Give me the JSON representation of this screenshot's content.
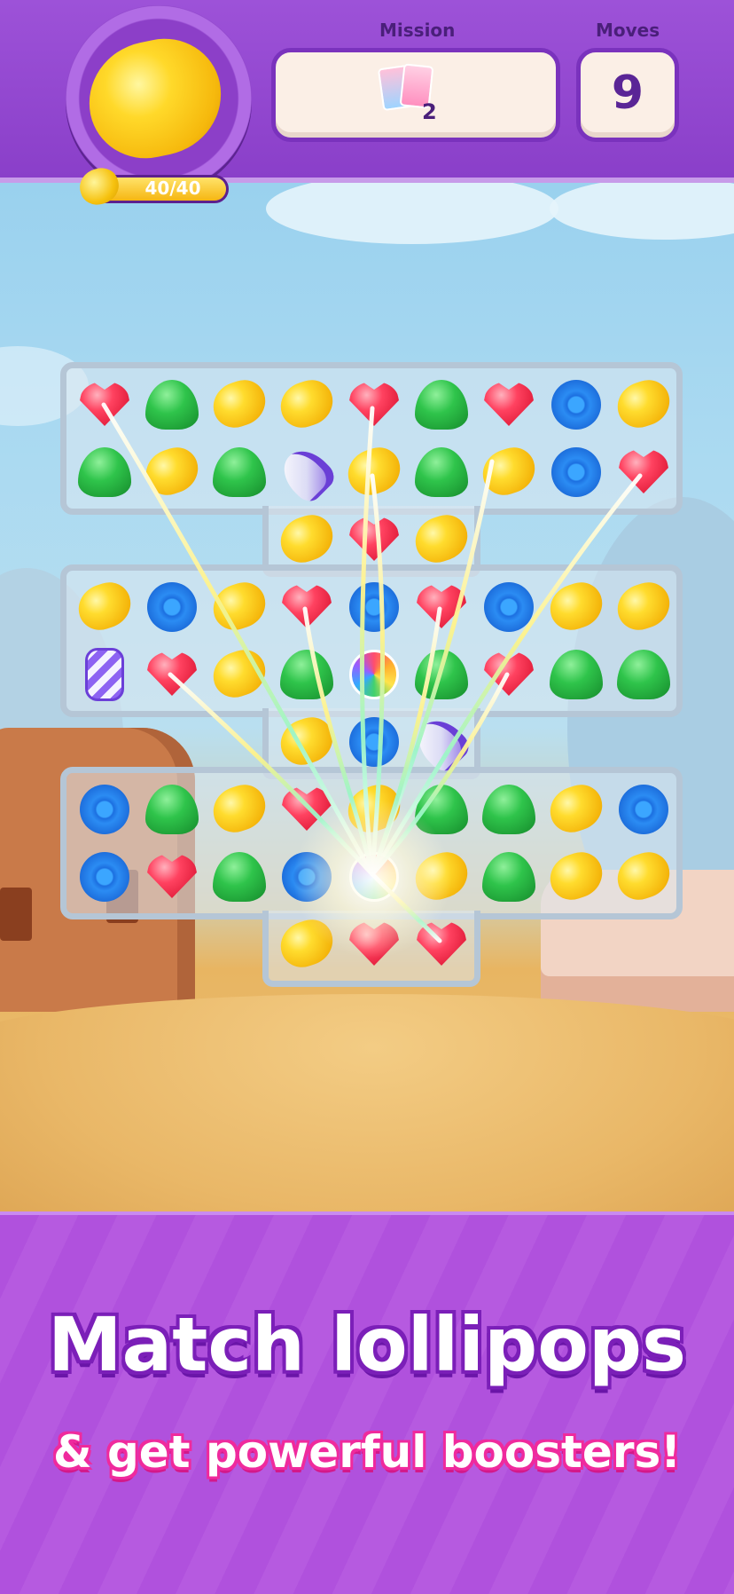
{
  "hud": {
    "goal_progress_text": "40/40",
    "goal_progress_fraction": 1.0,
    "mission_label": "Mission",
    "mission_count": "2",
    "moves_label": "Moves",
    "moves_value": "9"
  },
  "board": {
    "rows": [
      [
        "red",
        "green",
        "lemon",
        "lemon",
        "red",
        "green",
        "red",
        "blue",
        "lemon"
      ],
      [
        "green",
        "lemon",
        "green",
        "rocket",
        "lemon",
        "green",
        "lemon",
        "blue",
        "red"
      ],
      [
        null,
        null,
        null,
        "lemon",
        "red",
        "lemon",
        null,
        null,
        null
      ],
      [
        "lemon",
        "blue",
        "lemon",
        "red",
        "blue",
        "red",
        "blue",
        "lemon",
        "lemon"
      ],
      [
        "capsule",
        "red",
        "lemon",
        "green",
        "lollipop",
        "green",
        "red",
        "green",
        "green"
      ],
      [
        null,
        null,
        null,
        "lemon",
        "blue",
        "rocket",
        null,
        null,
        null
      ],
      [
        "blue",
        "green",
        "lemon",
        "red",
        "lemon",
        "green",
        "green",
        "lemon",
        "blue"
      ],
      [
        "blue",
        "red",
        "green",
        "blue",
        "lollipop",
        "lemon",
        "green",
        "lemon",
        "lemon"
      ],
      [
        null,
        null,
        null,
        "lemon",
        "red",
        "red",
        null,
        null,
        null
      ]
    ]
  },
  "banner": {
    "line1": "Match lollipops",
    "line2": "& get powerful boosters!"
  },
  "colors": {
    "header_purple": "#8a3fc9",
    "banner_purple": "#b051dd",
    "line2_outline": "#ef2a9d"
  }
}
